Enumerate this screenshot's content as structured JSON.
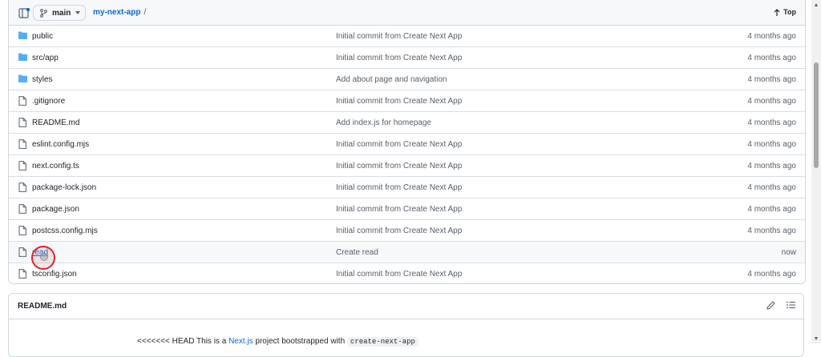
{
  "header": {
    "branch": "main",
    "breadcrumb_repo": "my-next-app",
    "breadcrumb_sep": "/",
    "top_label": "Top"
  },
  "files": [
    {
      "name": "public",
      "type": "folder",
      "message": "Initial commit from Create Next App",
      "age": "4 months ago"
    },
    {
      "name": "src/app",
      "type": "folder",
      "message": "Initial commit from Create Next App",
      "age": "4 months ago"
    },
    {
      "name": "styles",
      "type": "folder",
      "message": "Add about page and navigation",
      "age": "4 months ago"
    },
    {
      "name": ".gitignore",
      "type": "file",
      "message": "Initial commit from Create Next App",
      "age": "4 months ago"
    },
    {
      "name": "README.md",
      "type": "file",
      "message": "Add index.js for homepage",
      "age": "4 months ago"
    },
    {
      "name": "eslint.config.mjs",
      "type": "file",
      "message": "Initial commit from Create Next App",
      "age": "4 months ago"
    },
    {
      "name": "next.config.ts",
      "type": "file",
      "message": "Initial commit from Create Next App",
      "age": "4 months ago"
    },
    {
      "name": "package-lock.json",
      "type": "file",
      "message": "Initial commit from Create Next App",
      "age": "4 months ago"
    },
    {
      "name": "package.json",
      "type": "file",
      "message": "Initial commit from Create Next App",
      "age": "4 months ago"
    },
    {
      "name": "postcss.config.mjs",
      "type": "file",
      "message": "Initial commit from Create Next App",
      "age": "4 months ago"
    },
    {
      "name": "read",
      "type": "file",
      "message": "Create read",
      "age": "now"
    },
    {
      "name": "tsconfig.json",
      "type": "file",
      "message": "Initial commit from Create Next App",
      "age": "4 months ago"
    }
  ],
  "readme": {
    "title": "README.md",
    "body_prefix": "<<<<<<< HEAD This is a ",
    "body_link": "Next.js",
    "body_mid": " project bootstrapped with ",
    "body_code": "create-next-app"
  },
  "colors": {
    "link": "#0969da",
    "folder": "#54aeff",
    "muted": "#57606a",
    "click_marker": "#d12a2a"
  },
  "icons": {
    "folder": "folder-icon",
    "file": "file-icon",
    "branch": "git-branch-icon",
    "panel": "side-panel-icon",
    "arrow_up": "arrow-up-icon",
    "edit": "pencil-icon",
    "outline": "list-icon"
  }
}
